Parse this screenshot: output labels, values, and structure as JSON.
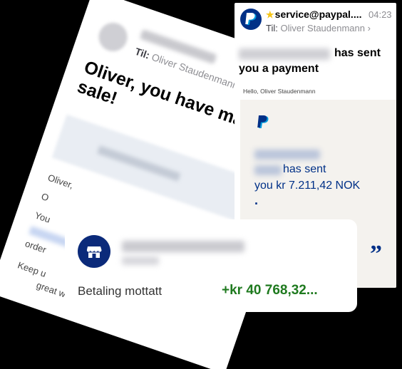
{
  "shopify_email": {
    "to_label": "Til:",
    "to_name": "Oliver Staudenmann",
    "headline": "Oliver, you have ma new sale!",
    "body_lines": [
      "Oliver,",
      "O",
      "You",
      "order",
      "Keep u",
      "great work!"
    ]
  },
  "paypal_email": {
    "sender": "service@paypal....",
    "time": "04:23",
    "to_label": "Til:",
    "to_name": "Oliver Staudenmann",
    "subject_part1": "has sent",
    "subject_part2": "you a payment",
    "greeting": "Hello, Oliver Staudenmann",
    "body_line1": "has sent",
    "body_line2": "you kr 7.211,42 NOK",
    "body_dot": ".",
    "quote": "”"
  },
  "bank_notification": {
    "label": "Betaling mottatt",
    "amount": "+kr 40 768,32...",
    "icon": "store-icon"
  },
  "colors": {
    "paypal_blue": "#003087",
    "paypal_light": "#009cde",
    "bank_icon": "#0b2a7a",
    "amount_green": "#1f7a1f",
    "star": "#f5c518"
  }
}
